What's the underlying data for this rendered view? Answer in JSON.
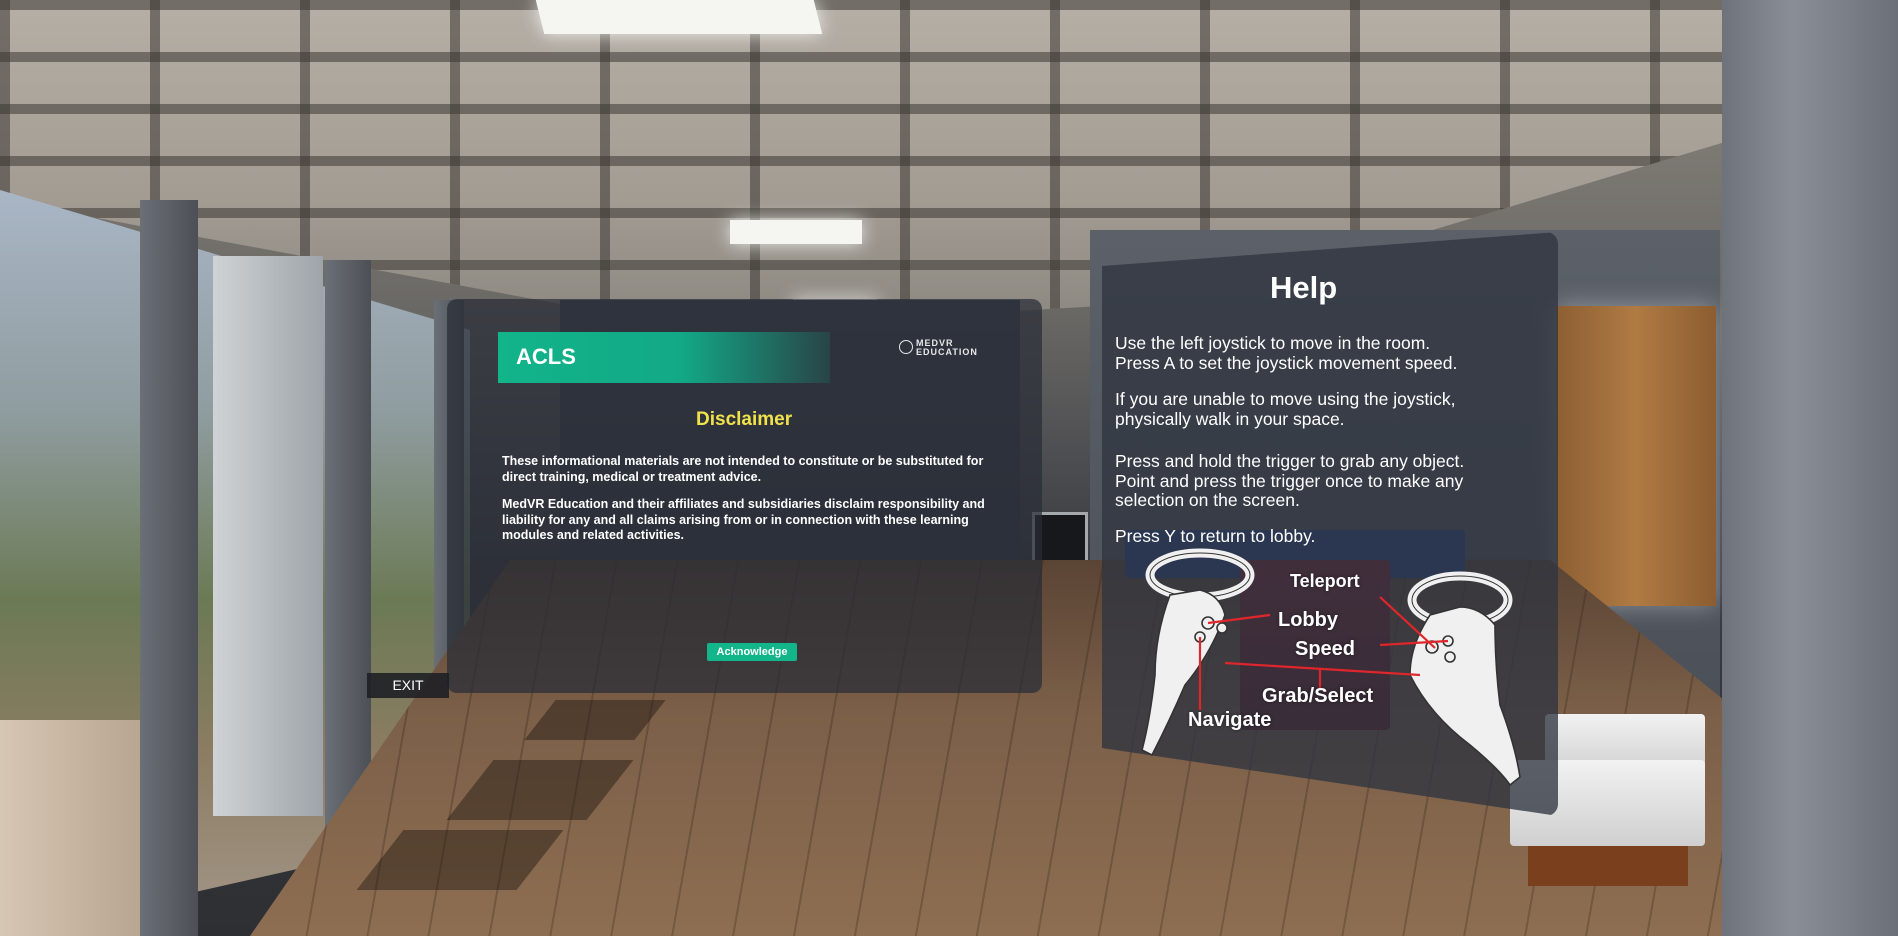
{
  "acls_panel": {
    "header_title": "ACLS",
    "brand_logo": {
      "line1": "MEDVR",
      "line2": "EDUCATION"
    },
    "disclaimer_title": "Disclaimer",
    "paragraph1": "These informational materials are not intended to constitute or be substituted for direct training, medical or treatment advice.",
    "paragraph2": "MedVR Education and their affiliates and subsidiaries disclaim responsibility and liability for any and all claims arising from or in connection with these learning modules and related activities.",
    "acknowledge_label": "Acknowledge"
  },
  "exit_label": "EXIT",
  "help_panel": {
    "title": "Help",
    "lines": [
      "Use the left joystick to move in the room.",
      "Press A to set the joystick movement speed.",
      "If you are unable to move using the joystick,",
      "physically walk in your space.",
      "Press and hold the trigger to grab any object.",
      "Point and press the trigger once to make any",
      "selection on the screen.",
      "Press Y to return to lobby."
    ],
    "controller_labels": {
      "teleport": "Teleport",
      "lobby": "Lobby",
      "speed": "Speed",
      "grab_select": "Grab/Select",
      "navigate": "Navigate"
    }
  },
  "colors": {
    "accent_green": "#13b58b",
    "disclaimer_yellow": "#f1e24b",
    "diagram_red": "#e0262b"
  }
}
